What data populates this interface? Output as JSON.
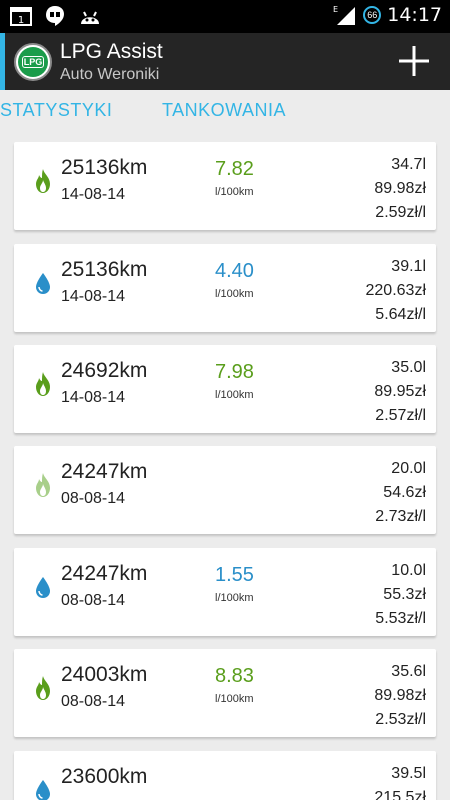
{
  "statusbar": {
    "time": "14:17",
    "badge": "66",
    "notif_count": "1"
  },
  "appbar": {
    "title": "LPG Assist",
    "subtitle": "Auto Weroniki",
    "logo_text": "LPG"
  },
  "tabs": [
    {
      "label": "STATYSTYKI"
    },
    {
      "label": "TANKOWANIA"
    }
  ],
  "colors": {
    "accent": "#33b5e5",
    "lpg_green": "#5a9e1c",
    "lpg_light": "#a8cf8a",
    "petrol_blue": "#2a8fc9"
  },
  "entries": [
    {
      "km": "25136km",
      "date": "14-08-14",
      "consumption": "7.82",
      "unit": "l/100km",
      "volume": "34.7l",
      "cost": "89.98zł",
      "price": "2.59zł/l",
      "fuel": "lpg",
      "icon": "flame-icon"
    },
    {
      "km": "25136km",
      "date": "14-08-14",
      "consumption": "4.40",
      "unit": "l/100km",
      "volume": "39.1l",
      "cost": "220.63zł",
      "price": "5.64zł/l",
      "fuel": "petrol",
      "icon": "drop-icon"
    },
    {
      "km": "24692km",
      "date": "14-08-14",
      "consumption": "7.98",
      "unit": "l/100km",
      "volume": "35.0l",
      "cost": "89.95zł",
      "price": "2.57zł/l",
      "fuel": "lpg",
      "icon": "flame-icon"
    },
    {
      "km": "24247km",
      "date": "08-08-14",
      "consumption": "",
      "unit": "",
      "volume": "20.0l",
      "cost": "54.6zł",
      "price": "2.73zł/l",
      "fuel": "lpg-light",
      "icon": "flame-icon"
    },
    {
      "km": "24247km",
      "date": "08-08-14",
      "consumption": "1.55",
      "unit": "l/100km",
      "volume": "10.0l",
      "cost": "55.3zł",
      "price": "5.53zł/l",
      "fuel": "petrol",
      "icon": "drop-icon"
    },
    {
      "km": "24003km",
      "date": "08-08-14",
      "consumption": "8.83",
      "unit": "l/100km",
      "volume": "35.6l",
      "cost": "89.98zł",
      "price": "2.53zł/l",
      "fuel": "lpg",
      "icon": "flame-icon"
    },
    {
      "km": "23600km",
      "date": "",
      "consumption": "",
      "unit": "",
      "volume": "39.5l",
      "cost": "215.5zł",
      "price": "",
      "fuel": "petrol",
      "icon": "drop-icon"
    }
  ]
}
